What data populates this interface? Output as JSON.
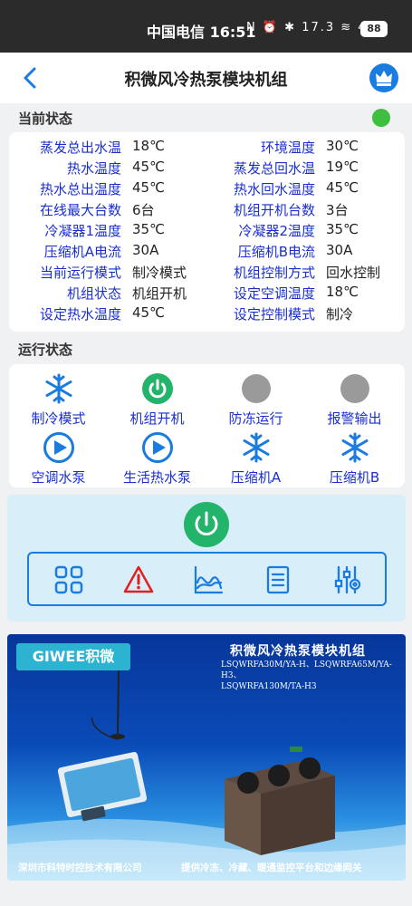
{
  "statusbar": {
    "carrier_time": "中国电信 16:51",
    "icons": "N ⏰ ✱ 17.3 ≋ 4G",
    "battery": "88"
  },
  "header": {
    "title": "积微风冷热泵模块机组"
  },
  "current_status": {
    "title": "当前状态",
    "indicator_color": "#3fbf3f",
    "rows": [
      {
        "l_label": "蒸发总出水温",
        "l_value": "18℃",
        "r_label": "环境温度",
        "r_value": "30℃"
      },
      {
        "l_label": "热水温度",
        "l_value": "45℃",
        "r_label": "蒸发总回水温",
        "r_value": "19℃"
      },
      {
        "l_label": "热水总出温度",
        "l_value": "45℃",
        "r_label": "热水回水温度",
        "r_value": "45℃"
      },
      {
        "l_label": "在线最大台数",
        "l_value": "6台",
        "r_label": "机组开机台数",
        "r_value": "3台"
      },
      {
        "l_label": "冷凝器1温度",
        "l_value": "35℃",
        "r_label": "冷凝器2温度",
        "r_value": "35℃"
      },
      {
        "l_label": "压缩机A电流",
        "l_value": "30A",
        "r_label": "压缩机B电流",
        "r_value": "30A"
      },
      {
        "l_label": "当前运行模式",
        "l_value": "制冷模式",
        "r_label": "机组控制方式",
        "r_value": "回水控制"
      },
      {
        "l_label": "机组状态",
        "l_value": "机组开机",
        "r_label": "设定空调温度",
        "r_value": "18℃"
      },
      {
        "l_label": "设定热水温度",
        "l_value": "45℃",
        "r_label": "设定控制模式",
        "r_value": "制冷"
      }
    ]
  },
  "run_status": {
    "title": "运行状态",
    "items": [
      {
        "label": "制冷模式",
        "icon": "snowflake-icon"
      },
      {
        "label": "机组开机",
        "icon": "power-on-icon"
      },
      {
        "label": "防冻运行",
        "icon": "gray-dot-icon"
      },
      {
        "label": "报警输出",
        "icon": "gray-dot-icon"
      },
      {
        "label": "空调水泵",
        "icon": "pump-play-icon"
      },
      {
        "label": "生活热水泵",
        "icon": "pump-play-icon"
      },
      {
        "label": "压缩机A",
        "icon": "snowflake-icon"
      },
      {
        "label": "压缩机B",
        "icon": "snowflake-icon"
      }
    ]
  },
  "controls": {
    "tools": [
      "grid-icon",
      "warning-icon",
      "chart-icon",
      "list-icon",
      "settings-sliders-icon"
    ]
  },
  "banner": {
    "logo": "GIWEE积微",
    "title": "积微风冷热泵模块机组",
    "models_line1": "LSQWRFA30M/YA-H、LSQWRFA65M/YA-H3、",
    "models_line2": "LSQWRFA130M/TA-H3",
    "company": "深圳市科特时控技术有限公司",
    "slogan": "提供冷冻、冷藏、暖通监控平台和边缘网关"
  },
  "colors": {
    "label_blue": "#1a2fd0",
    "accent_blue": "#1a7be0",
    "power_green": "#22b46a",
    "status_green": "#3fbf3f"
  }
}
